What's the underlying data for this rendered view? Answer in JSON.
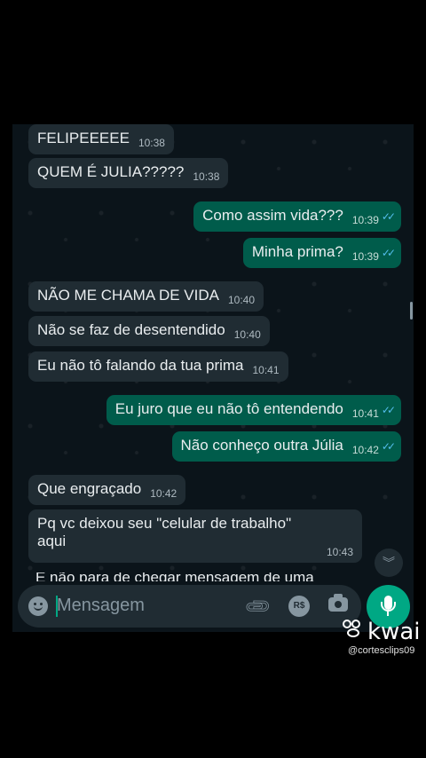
{
  "messages": [
    {
      "dir": "in",
      "text": "FELIPEEEEE",
      "time": "10:38"
    },
    {
      "dir": "in",
      "text": "QUEM É JULIA?????",
      "time": "10:38"
    },
    {
      "dir": "out",
      "text": "Como assim vida???",
      "time": "10:39",
      "status": "read"
    },
    {
      "dir": "out",
      "text": "Minha prima?",
      "time": "10:39",
      "status": "read"
    },
    {
      "dir": "in",
      "text": "NÃO ME CHAMA DE VIDA",
      "time": "10:40"
    },
    {
      "dir": "in",
      "text": "Não se faz de desentendido",
      "time": "10:40"
    },
    {
      "dir": "in",
      "text": "Eu não tô falando da tua prima",
      "time": "10:41"
    },
    {
      "dir": "out",
      "text": "Eu juro que eu não tô entendendo",
      "time": "10:41",
      "status": "read"
    },
    {
      "dir": "out",
      "text": "Não conheço outra Júlia",
      "time": "10:42",
      "status": "read"
    },
    {
      "dir": "in",
      "text": "Que engraçado",
      "time": "10:42"
    },
    {
      "dir": "in",
      "text": "Pq vc deixou seu \"celular de trabalho\" aqui",
      "time": "10:43"
    },
    {
      "dir": "in",
      "text": "E não para de chegar mensagem de uma",
      "time": ""
    }
  ],
  "composer": {
    "placeholder": "Mensagem"
  },
  "icons": {
    "emoji": "emoji-icon",
    "attach": "paperclip-icon",
    "payment": "payment-icon",
    "camera": "camera-icon",
    "mic": "microphone-icon",
    "scroll_down": "chevron-double-down-icon"
  },
  "payment_label": "R$",
  "read_ticks": "✓✓",
  "watermark": {
    "brand": "kwai",
    "handle": "@cortesclips09"
  },
  "colors": {
    "background": "#0b141a",
    "incoming": "#202c33",
    "outgoing": "#005c4b",
    "accent": "#00a884",
    "read": "#53bdeb"
  }
}
